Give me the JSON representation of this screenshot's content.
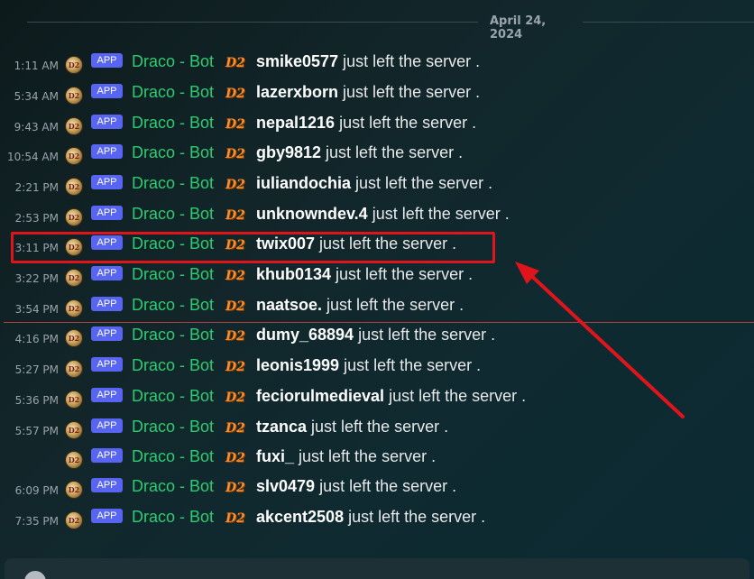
{
  "channel": {
    "date_divider": "April 24, 2024",
    "messages": [
      {
        "time": "1:11 AM",
        "badge": "APP",
        "bot": "Draco - Bot",
        "user": "smike0577",
        "text": " just left the server ."
      },
      {
        "time": "5:34 AM",
        "badge": "APP",
        "bot": "Draco - Bot",
        "user": "lazerxborn",
        "text": " just left the server ."
      },
      {
        "time": "9:43 AM",
        "badge": "APP",
        "bot": "Draco - Bot",
        "user": "nepal1216",
        "text": " just left the server ."
      },
      {
        "time": "10:54 AM",
        "badge": "APP",
        "bot": "Draco - Bot",
        "user": "gby9812",
        "text": " just left the server ."
      },
      {
        "time": "2:21 PM",
        "badge": "APP",
        "bot": "Draco - Bot",
        "user": "iuliandochia",
        "text": " just left the server ."
      },
      {
        "time": "2:53 PM",
        "badge": "APP",
        "bot": "Draco - Bot",
        "user": "unknowndev.4",
        "text": " just left the server ."
      },
      {
        "time": "3:11 PM",
        "badge": "APP",
        "bot": "Draco - Bot",
        "user": "twix007",
        "text": " just left the server ."
      },
      {
        "time": "3:22 PM",
        "badge": "APP",
        "bot": "Draco - Bot",
        "user": "khub0134",
        "text": " just left the server ."
      },
      {
        "time": "3:54 PM",
        "badge": "APP",
        "bot": "Draco - Bot",
        "user": "naatsoe.",
        "text": " just left the server ."
      },
      {
        "time": "4:16 PM",
        "badge": "APP",
        "bot": "Draco - Bot",
        "user": "dumy_68894",
        "text": " just left the server ."
      },
      {
        "time": "5:27 PM",
        "badge": "APP",
        "bot": "Draco - Bot",
        "user": "leonis1999",
        "text": " just left the server ."
      },
      {
        "time": "5:36 PM",
        "badge": "APP",
        "bot": "Draco - Bot",
        "user": "feciorulmedieval",
        "text": " just left the server ."
      },
      {
        "time": "5:57 PM",
        "badge": "APP",
        "bot": "Draco - Bot",
        "user": "tzanca",
        "text": " just left the server ."
      },
      {
        "time": "",
        "badge": "APP",
        "bot": "Draco - Bot",
        "user": "fuxi_",
        "text": " just left the server ."
      },
      {
        "time": "6:09 PM",
        "badge": "APP",
        "bot": "Draco - Bot",
        "user": "slv0479",
        "text": " just left the server ."
      },
      {
        "time": "7:35 PM",
        "badge": "APP",
        "bot": "Draco - Bot",
        "user": "akcent2508",
        "text": " just left the server ."
      }
    ],
    "avatar_icon": "draco-bot-avatar-icon",
    "bot_tag_icon": "d2-logo-icon",
    "d2_text": "D2",
    "avatar_text": "D2"
  },
  "annotation": {
    "highlight_color": "#e0141b",
    "arrow_color": "#e0141b"
  },
  "colors": {
    "bot_name": "#2ecc71",
    "app_badge": "#5865f2",
    "new_messages_line": "#b3403d"
  }
}
